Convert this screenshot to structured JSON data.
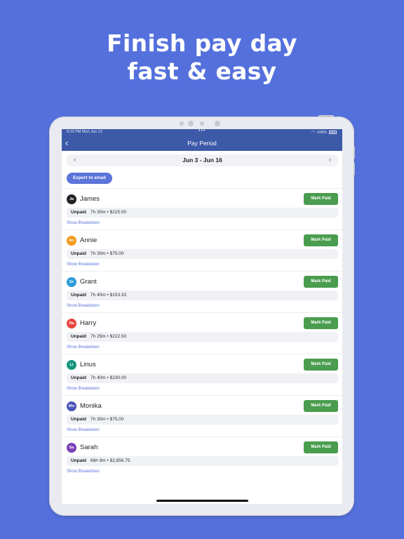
{
  "headline": {
    "line1": "Finish pay day",
    "line2": "fast & easy"
  },
  "status_bar": {
    "time": "9:22 PM  Mon Jun 12",
    "dots": "•••",
    "battery": "100%"
  },
  "nav": {
    "title": "Pay Period",
    "back_icon": "chevron-left-icon"
  },
  "period": {
    "label": "Jun 3 - Jun 16",
    "prev": "‹",
    "next": "›"
  },
  "export": {
    "label": "Export to email"
  },
  "colors": {
    "accent": "#5b74d9",
    "nav_bg": "#3d5aa8",
    "mark_paid": "#4a9d4e",
    "page_bg": "#5470dc"
  },
  "employees": [
    {
      "initials": "Ja",
      "name": "James",
      "avatar_color": "#1f2226",
      "status": "Unpaid",
      "summary": "7h 30m • $225.00",
      "action": "Mark Paid",
      "link": "Show Breakdown"
    },
    {
      "initials": "An",
      "name": "Annie",
      "avatar_color": "#f39a1c",
      "status": "Unpaid",
      "summary": "7h 30m • $75.00",
      "action": "Mark Paid",
      "link": "Show Breakdown"
    },
    {
      "initials": "Gr",
      "name": "Grant",
      "avatar_color": "#2b9bd8",
      "status": "Unpaid",
      "summary": "7h 40m • $153.33",
      "action": "Mark Paid",
      "link": "Show Breakdown"
    },
    {
      "initials": "Ha",
      "name": "Harry",
      "avatar_color": "#e5463e",
      "status": "Unpaid",
      "summary": "7h 25m • $222.50",
      "action": "Mark Paid",
      "link": "Show Breakdown"
    },
    {
      "initials": "Li",
      "name": "Linus",
      "avatar_color": "#17947e",
      "status": "Unpaid",
      "summary": "7h 40m • $230.00",
      "action": "Mark Paid",
      "link": "Show Breakdown"
    },
    {
      "initials": "Mo",
      "name": "Monika",
      "avatar_color": "#4a55b8",
      "status": "Unpaid",
      "summary": "7h 30m • $75.00",
      "action": "Mark Paid",
      "link": "Show Breakdown"
    },
    {
      "initials": "Sa",
      "name": "Sarah",
      "avatar_color": "#7a3eb5",
      "status": "Unpaid",
      "summary": "66h 9m • $2,856.75",
      "action": "Mark Paid",
      "link": "Show Breakdown"
    }
  ]
}
